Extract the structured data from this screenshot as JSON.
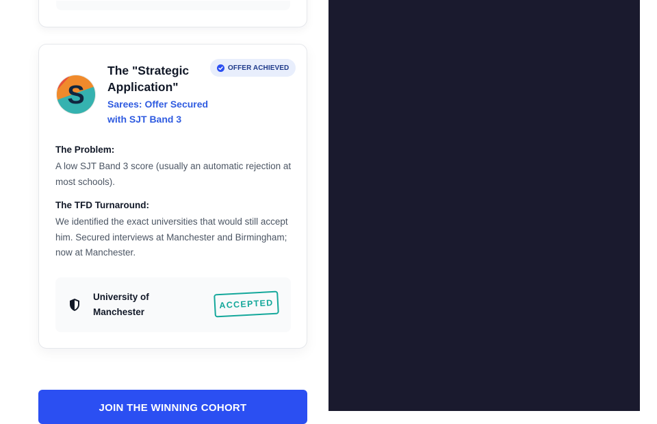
{
  "case_study": {
    "title": "The \"Strategic Application\"",
    "subtitle": "Sarees: Offer Secured with SJT Band 3",
    "badge": "OFFER ACHIEVED",
    "avatar_letter": "S",
    "problem_label": "The Problem:",
    "problem_text": "A low SJT Band 3 score (usually an automatic rejection at most schools).",
    "turnaround_label": "The TFD Turnaround:",
    "turnaround_text": "We identified the exact universities that would still accept him. Secured interviews at Manchester and Birmingham; now at Manchester.",
    "university": "University of Manchester",
    "status_stamp": "ACCEPTED"
  },
  "cta": {
    "label": "JOIN THE WINNING COHORT"
  },
  "colors": {
    "accent_blue": "#2b4ff2",
    "subtitle_blue": "#2f5be0",
    "badge_bg": "#e8eefc",
    "stamp_teal": "#13a79a",
    "dark_panel": "#1a1a2e"
  },
  "icons": {
    "badge": "check-circle-icon",
    "university": "shield-icon"
  }
}
